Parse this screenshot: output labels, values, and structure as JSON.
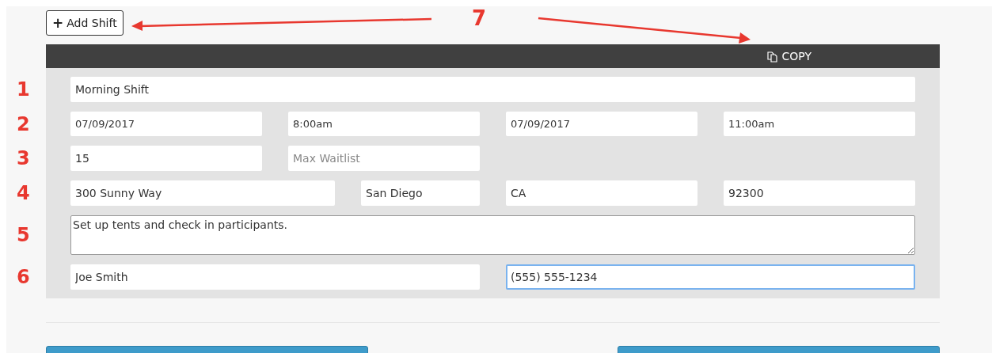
{
  "toolbar": {
    "add_button": {
      "icon": "+",
      "label": "Add Shift"
    }
  },
  "header": {
    "copy_label": "COPY"
  },
  "rows": [
    {
      "kind": "title",
      "marker": "1",
      "fields": [
        {
          "value": "Morning Shift",
          "focused": false
        }
      ]
    },
    {
      "kind": "dates",
      "marker": "2",
      "fields": [
        {
          "value": "07/09/2017",
          "focused": false
        },
        {
          "value": "8:00am",
          "focused": false
        },
        {
          "value": "07/09/2017",
          "focused": false
        },
        {
          "value": "11:00am",
          "focused": false
        }
      ]
    },
    {
      "kind": "capacity",
      "marker": "3",
      "fields": [
        {
          "value": "15",
          "focused": false
        },
        {
          "placeholder": "Max Waitlist",
          "focused": false
        }
      ]
    },
    {
      "kind": "address",
      "marker": "4",
      "fields": [
        {
          "value": "300 Sunny Way",
          "focused": false
        },
        {
          "value": "San Diego",
          "focused": false
        },
        {
          "value": "CA",
          "focused": false
        },
        {
          "value": "92300",
          "focused": false
        }
      ]
    },
    {
      "kind": "notes",
      "marker": "5",
      "fields": [
        {
          "value": "Set up tents and check in participants.",
          "focused": false
        }
      ]
    },
    {
      "kind": "contact",
      "marker": "6",
      "fields": [
        {
          "value": "Joe Smith",
          "focused": false
        },
        {
          "value": "(555) 555-1234",
          "focused": true
        }
      ]
    }
  ],
  "annotation": {
    "marker": "7"
  }
}
